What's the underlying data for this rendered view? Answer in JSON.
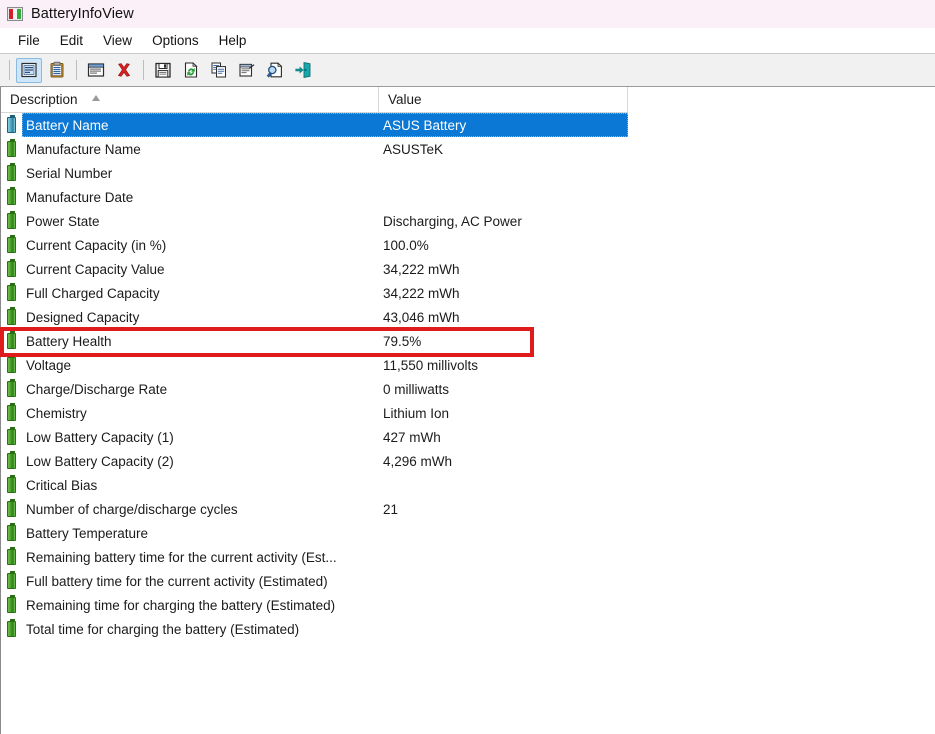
{
  "window": {
    "title": "BatteryInfoView",
    "app_icon": "battery-app-icon"
  },
  "menubar": {
    "items": [
      {
        "label": "File"
      },
      {
        "label": "Edit"
      },
      {
        "label": "View"
      },
      {
        "label": "Options"
      },
      {
        "label": "Help"
      }
    ]
  },
  "toolbar": {
    "buttons": [
      {
        "icon": "properties-view-icon",
        "active": true
      },
      {
        "icon": "clipboard-icon",
        "active": false
      },
      {
        "sep": true
      },
      {
        "icon": "window-properties-icon",
        "active": false
      },
      {
        "icon": "delete-red-x-icon",
        "active": false
      },
      {
        "sep": true
      },
      {
        "icon": "save-floppy-icon",
        "active": false
      },
      {
        "icon": "refresh-icon",
        "active": false
      },
      {
        "icon": "copy-icon",
        "active": false
      },
      {
        "icon": "html-report-icon",
        "active": false
      },
      {
        "icon": "find-icon",
        "active": false
      },
      {
        "icon": "exit-icon",
        "active": false
      }
    ]
  },
  "listview": {
    "columns": [
      {
        "label": "Description",
        "sorted": true,
        "sort_direction": "ascending"
      },
      {
        "label": "Value",
        "sorted": false
      }
    ],
    "rows": [
      {
        "icon": "battery-icon",
        "description": "Battery Name",
        "value": "ASUS Battery",
        "selected": true
      },
      {
        "icon": "battery-icon",
        "description": "Manufacture Name",
        "value": "ASUSTeK",
        "selected": false
      },
      {
        "icon": "battery-icon",
        "description": "Serial Number",
        "value": "",
        "selected": false
      },
      {
        "icon": "battery-icon",
        "description": "Manufacture Date",
        "value": "",
        "selected": false
      },
      {
        "icon": "battery-icon",
        "description": "Power State",
        "value": "Discharging, AC Power",
        "selected": false
      },
      {
        "icon": "battery-icon",
        "description": "Current Capacity (in %)",
        "value": "100.0%",
        "selected": false
      },
      {
        "icon": "battery-icon",
        "description": "Current Capacity Value",
        "value": "34,222 mWh",
        "selected": false
      },
      {
        "icon": "battery-icon",
        "description": "Full Charged Capacity",
        "value": "34,222 mWh",
        "selected": false
      },
      {
        "icon": "battery-icon",
        "description": "Designed Capacity",
        "value": "43,046 mWh",
        "selected": false
      },
      {
        "icon": "battery-icon",
        "description": "Battery Health",
        "value": "79.5%",
        "selected": false,
        "highlighted": true
      },
      {
        "icon": "battery-icon",
        "description": "Voltage",
        "value": "11,550 millivolts",
        "selected": false
      },
      {
        "icon": "battery-icon",
        "description": "Charge/Discharge Rate",
        "value": "0 milliwatts",
        "selected": false
      },
      {
        "icon": "battery-icon",
        "description": "Chemistry",
        "value": "Lithium Ion",
        "selected": false
      },
      {
        "icon": "battery-icon",
        "description": "Low Battery Capacity (1)",
        "value": "427 mWh",
        "selected": false
      },
      {
        "icon": "battery-icon",
        "description": "Low Battery Capacity (2)",
        "value": "4,296 mWh",
        "selected": false
      },
      {
        "icon": "battery-icon",
        "description": "Critical Bias",
        "value": "",
        "selected": false
      },
      {
        "icon": "battery-icon",
        "description": "Number of charge/discharge cycles",
        "value": "21",
        "selected": false
      },
      {
        "icon": "battery-icon",
        "description": "Battery Temperature",
        "value": "",
        "selected": false
      },
      {
        "icon": "battery-icon",
        "description": "Remaining battery time for the current activity (Est...",
        "value": "",
        "selected": false
      },
      {
        "icon": "battery-icon",
        "description": "Full battery time for the current activity (Estimated)",
        "value": "",
        "selected": false
      },
      {
        "icon": "battery-icon",
        "description": "Remaining time for charging the battery (Estimated)",
        "value": "",
        "selected": false
      },
      {
        "icon": "battery-icon",
        "description": "Total  time for charging the battery (Estimated)",
        "value": "",
        "selected": false
      }
    ]
  },
  "annotation": {
    "highlight_color": "#e01b1b",
    "target_row": "Battery Health"
  },
  "colors": {
    "selection_blue": "#0a78d4",
    "titlebar": "#fbf0f7",
    "toolbar": "#f1f1f1",
    "battery_green": "#3f9a22"
  }
}
